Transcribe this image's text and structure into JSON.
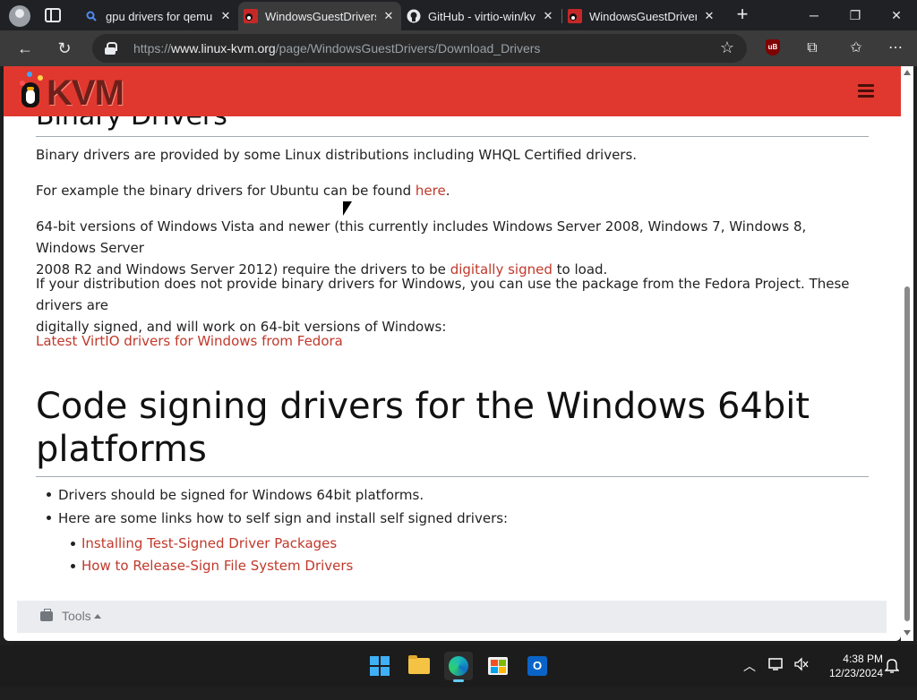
{
  "browser": {
    "tabs": [
      {
        "title": "gpu drivers for qemu",
        "icon": "search-favicon",
        "active": false
      },
      {
        "title": "WindowsGuestDrivers",
        "icon": "kvm-favicon",
        "active": true
      },
      {
        "title": "GitHub - virtio-win/kv",
        "icon": "github-favicon",
        "active": false
      },
      {
        "title": "WindowsGuestDrivers",
        "icon": "kvm-favicon",
        "active": false
      }
    ],
    "close_glyph": "✕",
    "new_tab_glyph": "+",
    "window_controls": {
      "minimize": "─",
      "restore": "❐",
      "close": "✕"
    },
    "nav": {
      "back": "←",
      "reload": "↻"
    },
    "url": {
      "scheme": "https://",
      "host": "www.linux-kvm.org",
      "path": "/page/WindowsGuestDrivers/Download_Drivers"
    },
    "favorite_glyph": "☆",
    "toolbar_icons": {
      "ublock": "uB",
      "extensions": "⧉",
      "favorites": "✩",
      "more": "⋯"
    }
  },
  "site": {
    "logo_text": "KVM",
    "colors": {
      "header": "#e0382e",
      "link": "#c0392b"
    }
  },
  "article": {
    "section1_title": "Binary Drivers",
    "p1": "Binary drivers are provided by some Linux distributions including WHQL Certified drivers.",
    "p2_before": "For example the binary drivers for Ubuntu can be found ",
    "p2_link": "here",
    "p2_after": ".",
    "p3_line1": "64-bit versions of Windows Vista and newer (this currently includes Windows Server 2008, Windows 7, Windows 8, Windows Server",
    "p3_line2_before": "2008 R2 and Windows Server 2012) require the drivers to be ",
    "p3_link": "digitally signed",
    "p3_after": " to load.",
    "p4_line1": "If your distribution does not provide binary drivers for Windows, you can use the package from the Fedora Project. These drivers are",
    "p4_line2": "digitally signed, and will work on 64-bit versions of Windows:",
    "fedora_link": "Latest VirtIO drivers for Windows from Fedora",
    "section2_title_line1": "Code signing drivers for the Windows 64bit",
    "section2_title_line2": "platforms",
    "bullets": [
      "Drivers should be signed for Windows 64bit platforms.",
      "Here are some links how to self sign and install self signed drivers:"
    ],
    "sub_links": [
      "Installing Test-Signed Driver Packages",
      "How to Release-Sign File System Drivers"
    ],
    "tools_label": "Tools"
  },
  "taskbar": {
    "apps": [
      "start-button",
      "file-explorer",
      "edge",
      "microsoft-store",
      "outlook"
    ],
    "tray": {
      "chevron": "︿",
      "time": "4:38 PM",
      "date": "12/23/2024"
    }
  }
}
